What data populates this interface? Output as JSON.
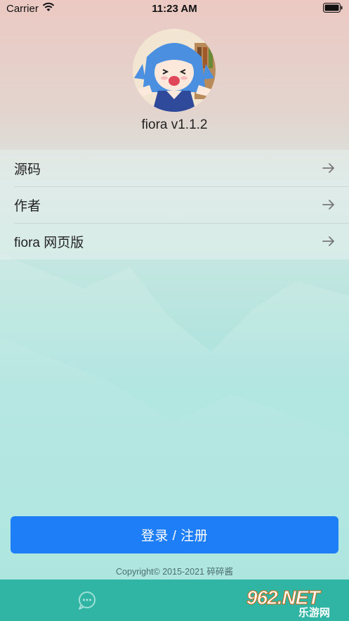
{
  "status_bar": {
    "carrier": "Carrier",
    "time": "11:23 AM"
  },
  "profile": {
    "avatar_icon": "anime-girl-avatar",
    "version": "fiora v1.1.2"
  },
  "menu": {
    "items": [
      {
        "label": "源码"
      },
      {
        "label": "作者"
      },
      {
        "label": "fiora 网页版"
      }
    ]
  },
  "login": {
    "button_label": "登录 / 注册"
  },
  "footer": {
    "copyright": "Copyright© 2015-2021 碎碎酱"
  },
  "tab_bar": {
    "chat_icon": "chat-bubble-icon"
  },
  "watermark": {
    "logo": "962.NET",
    "subtitle": "乐游网"
  },
  "colors": {
    "accent": "#1e7ef7",
    "tab_bar": "#30b4a4"
  }
}
